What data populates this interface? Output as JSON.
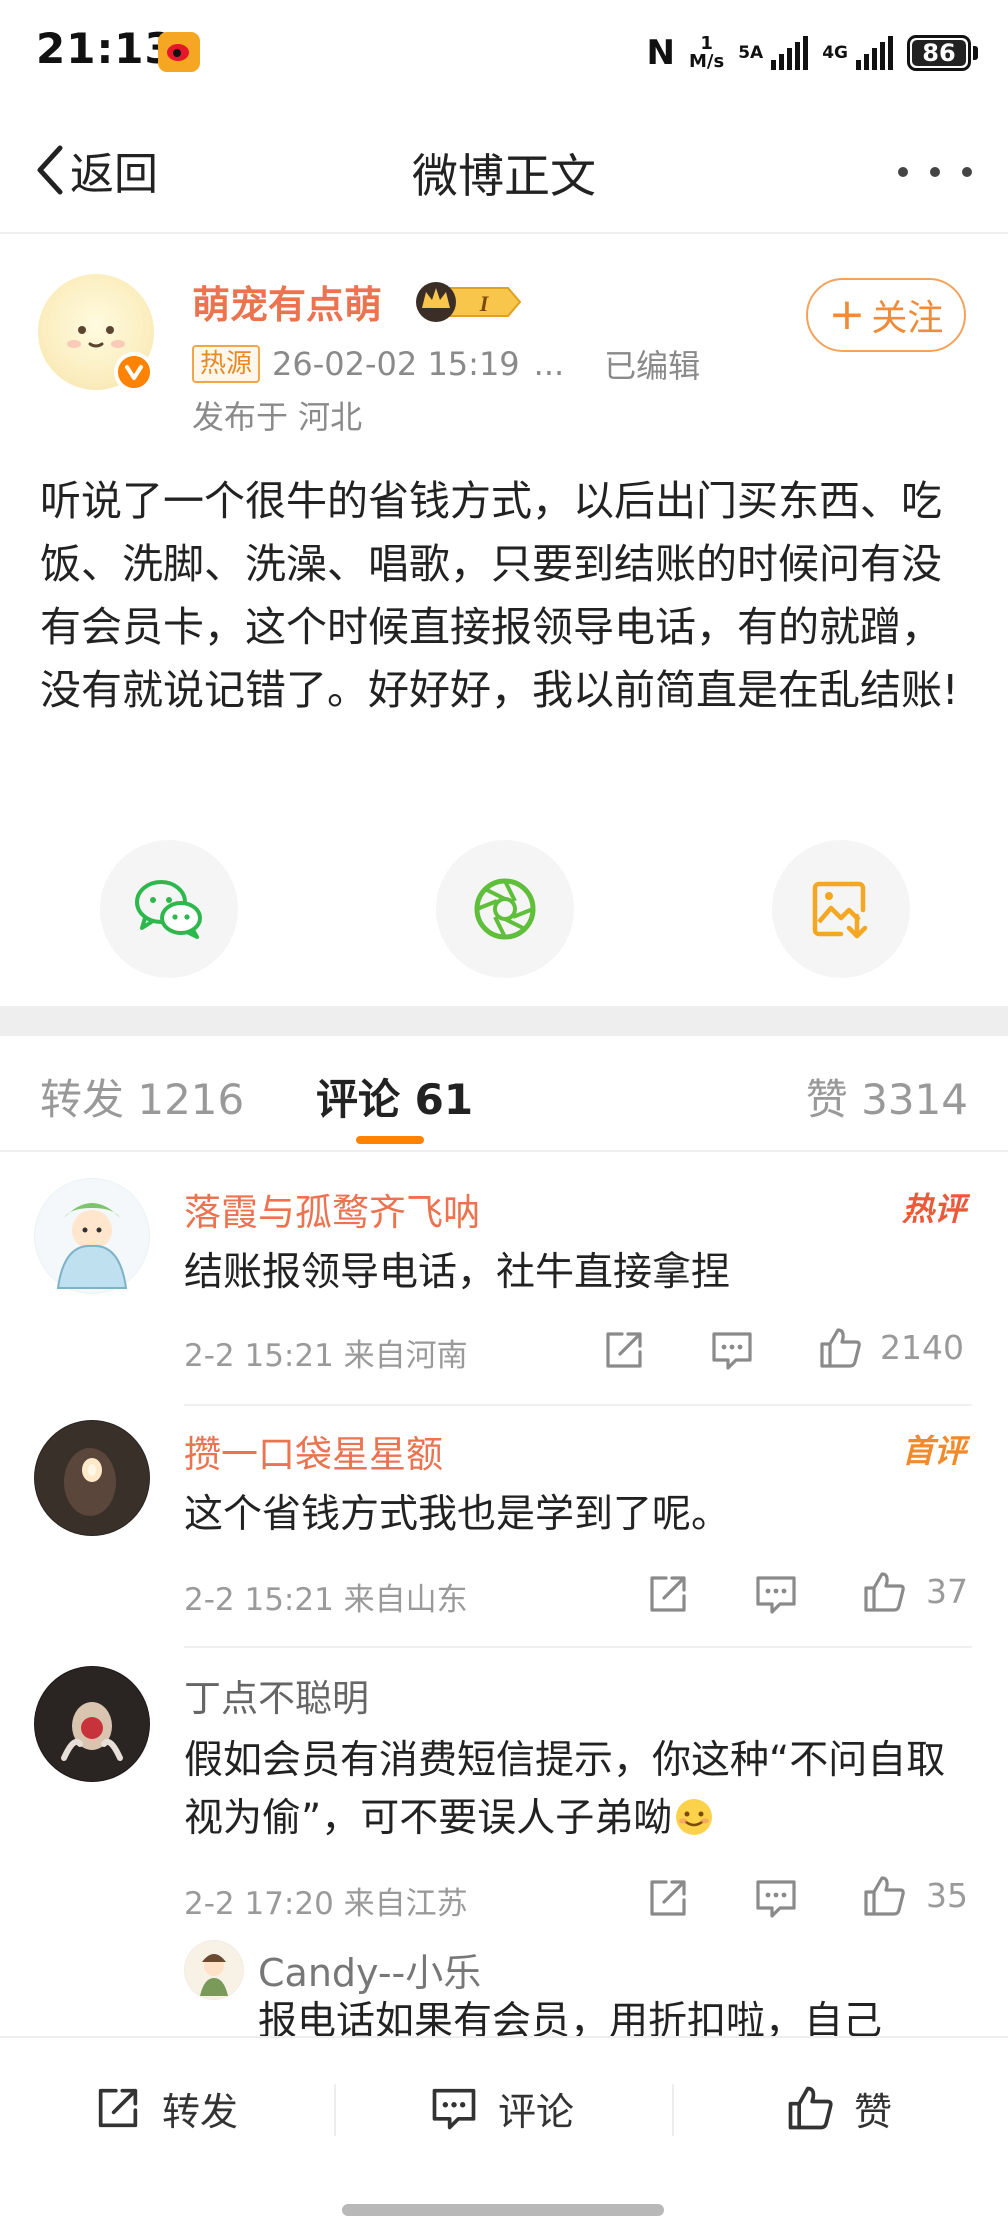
{
  "status_bar": {
    "time": "21:13",
    "network_speed_value": "1",
    "network_speed_unit": "M/s",
    "sim1_label": "5A",
    "sim2_label": "4G",
    "battery": "86"
  },
  "nav": {
    "back_label": "返回",
    "title": "微博正文"
  },
  "post": {
    "author": "萌宠有点萌",
    "level_badge": "I",
    "hot_badge": "热源",
    "timestamp": "26-02-02 15:19",
    "ellipsis": "...",
    "edited": "已编辑",
    "location": "发布于 河北",
    "follow_label": "关注",
    "body": "听说了一个很牛的省钱方式，以后出门买东西、吃饭、洗脚、洗澡、唱歌，只要到结账的时候问有没有会员卡，这个时候直接报领导电话，有的就蹭，没有就说记错了。好好好，我以前简直是在乱结账!"
  },
  "tabs": {
    "repost": "转发 1216",
    "comment": "评论 61",
    "like": "赞 3314"
  },
  "comments": [
    {
      "name": "落霞与孤鹜齐飞呐",
      "tag": "热评",
      "text": "结账报领导电话，社牛直接拿捏",
      "meta": "2-2 15:21 来自河南",
      "likes": "2140"
    },
    {
      "name": "攒一口袋星星额",
      "tag": "首评",
      "text": "这个省钱方式我也是学到了呢。",
      "meta": "2-2 15:21 来自山东",
      "likes": "37"
    },
    {
      "name": "丁点不聪明",
      "text": "假如会员有消费短信提示，你这种“不问自取视为偷”，可不要误人子弟呦",
      "meta": "2-2 17:20 来自江苏",
      "likes": "35"
    }
  ],
  "reply": {
    "name": "Candy--小乐",
    "text": "报电话如果有会员，用折扣啦，自己"
  },
  "bottom_bar": {
    "repost": "转发",
    "comment": "评论",
    "like": "赞"
  },
  "colors": {
    "accent_orange": "#ff8200",
    "username_orange": "#eb7350",
    "wechat_green": "#2db84d",
    "moments_green": "#5fbf3a",
    "save_orange": "#f5a623"
  }
}
